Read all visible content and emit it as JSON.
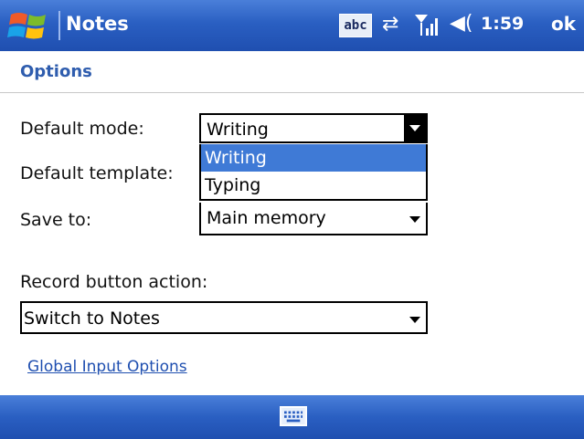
{
  "titlebar": {
    "app_title": "Notes",
    "input_indicator": "abc",
    "time": "1:59",
    "ok_label": "ok",
    "icons": [
      "windows-start-icon",
      "sync-icon",
      "signal-icon",
      "volume-icon"
    ]
  },
  "page": {
    "heading": "Options"
  },
  "form": {
    "default_mode_label": "Default mode:",
    "default_mode_value": "Writing",
    "default_mode_options": [
      "Writing",
      "Typing"
    ],
    "default_template_label": "Default template:",
    "save_to_label": "Save to:",
    "save_to_value": "Main memory",
    "record_button_label": "Record button action:",
    "record_button_value": "Switch to Notes"
  },
  "links": {
    "global_input": "Global Input Options"
  },
  "bottombar": {
    "icon": "keyboard-icon"
  },
  "colors": {
    "titlebar": "#2a5fc2",
    "selection": "#3f7ad6",
    "heading": "#2f5dae"
  }
}
